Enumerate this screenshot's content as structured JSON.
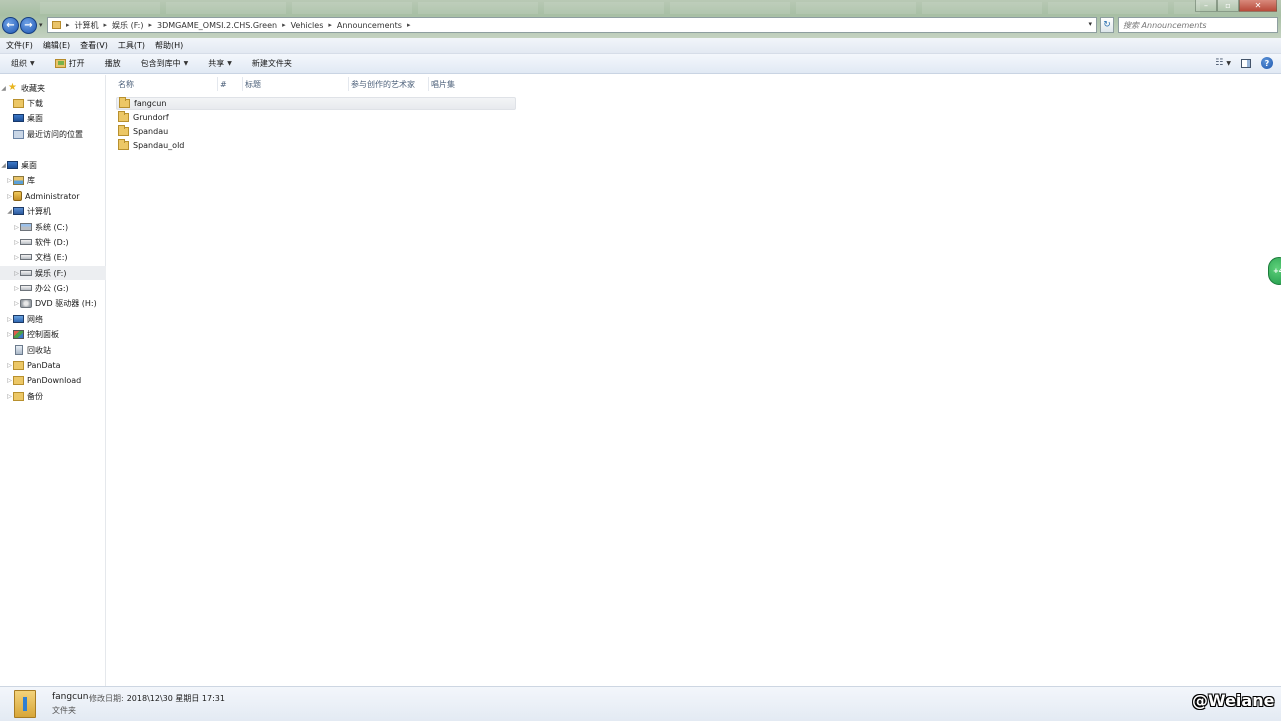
{
  "window": {
    "minimize_label": "–",
    "maximize_label": "▫",
    "close_label": "✕"
  },
  "address": {
    "breadcrumbs": [
      "计算机",
      "娱乐 (F:)",
      "3DMGAME_OMSI.2.CHS.Green",
      "Vehicles",
      "Announcements"
    ],
    "separator": "▸"
  },
  "search": {
    "placeholder": "搜索 Announcements"
  },
  "menu": {
    "items": [
      "文件(F)",
      "编辑(E)",
      "查看(V)",
      "工具(T)",
      "帮助(H)"
    ]
  },
  "toolbar": {
    "organize": "组织",
    "open": "打开",
    "play": "播放",
    "include_in_library": "包含到库中",
    "share": "共享",
    "new_folder": "新建文件夹"
  },
  "navpane": {
    "items": [
      {
        "label": "收藏夹",
        "icon": "star-icon"
      },
      {
        "label": "下载",
        "icon": "folder-icon"
      },
      {
        "label": "桌面",
        "icon": "desktop-icon"
      },
      {
        "label": "最近访问的位置",
        "icon": "recent-places-icon"
      },
      {
        "label": "桌面",
        "icon": "desktop-icon"
      },
      {
        "label": "库",
        "icon": "library-icon"
      },
      {
        "label": "Administrator",
        "icon": "user-folder-icon"
      },
      {
        "label": "计算机",
        "icon": "computer-icon"
      },
      {
        "label": "系统 (C:)",
        "icon": "system-drive-icon"
      },
      {
        "label": "软件 (D:)",
        "icon": "drive-icon"
      },
      {
        "label": "文档 (E:)",
        "icon": "drive-icon"
      },
      {
        "label": "娱乐 (F:)",
        "icon": "drive-icon"
      },
      {
        "label": "办公 (G:)",
        "icon": "drive-icon"
      },
      {
        "label": "DVD 驱动器 (H:)",
        "icon": "dvd-drive-icon"
      },
      {
        "label": "网络",
        "icon": "network-icon"
      },
      {
        "label": "控制面板",
        "icon": "control-panel-icon"
      },
      {
        "label": "回收站",
        "icon": "recycle-bin-icon"
      },
      {
        "label": "PanData",
        "icon": "folder-icon"
      },
      {
        "label": "PanDownload",
        "icon": "folder-icon"
      },
      {
        "label": "备份",
        "icon": "folder-icon"
      }
    ]
  },
  "columns": {
    "name": "名称",
    "number": "#",
    "title": "标题",
    "artists": "参与创作的艺术家",
    "album": "唱片集"
  },
  "files": [
    {
      "name": "fangcun"
    },
    {
      "name": "Grundorf"
    },
    {
      "name": "Spandau"
    },
    {
      "name": "Spandau_old"
    }
  ],
  "details": {
    "name": "fangcun",
    "modified_label": "修改日期:",
    "modified_value": "2018\\12\\30 星期日 17:31",
    "type": "文件夹"
  },
  "edge_widget_text": "+4",
  "watermark": "@Weiane"
}
